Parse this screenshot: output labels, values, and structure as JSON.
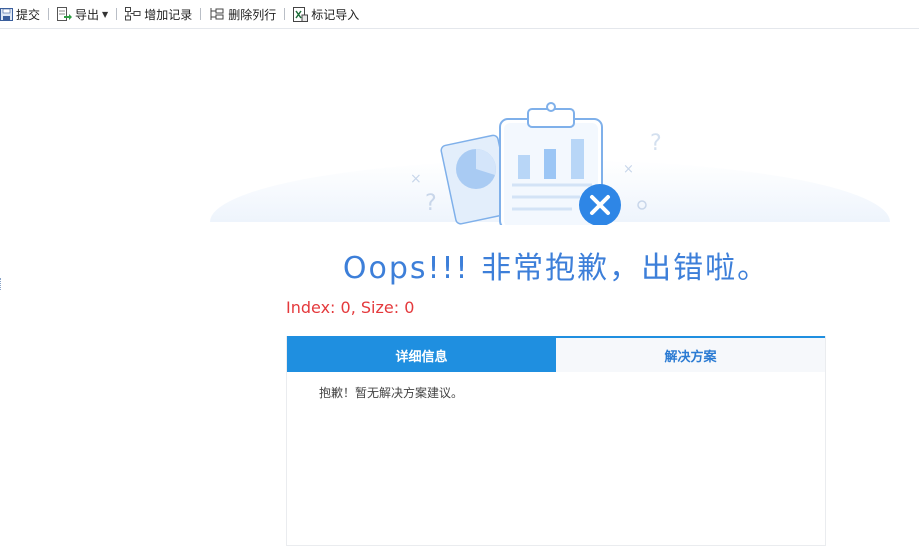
{
  "toolbar": {
    "items": [
      {
        "label": "提交",
        "icon": "save-icon"
      },
      {
        "label": "导出",
        "icon": "export-icon",
        "has_dropdown": true
      },
      {
        "label": "增加记录",
        "icon": "add-record-icon"
      },
      {
        "label": "删除列行",
        "icon": "delete-row-icon"
      },
      {
        "label": "标记导入",
        "icon": "excel-import-icon"
      }
    ]
  },
  "error": {
    "headline": "Oops!!! 非常抱歉，出错啦。",
    "message": "Index: 0, Size: 0"
  },
  "tabs": [
    {
      "label": "详细信息",
      "active": true
    },
    {
      "label": "解决方案",
      "active": false
    }
  ],
  "panel": {
    "content": "抱歉！暂无解决方案建议。"
  },
  "colors": {
    "accent": "#1f8fe0",
    "headline": "#3d7fd9",
    "error": "#e4393c"
  }
}
